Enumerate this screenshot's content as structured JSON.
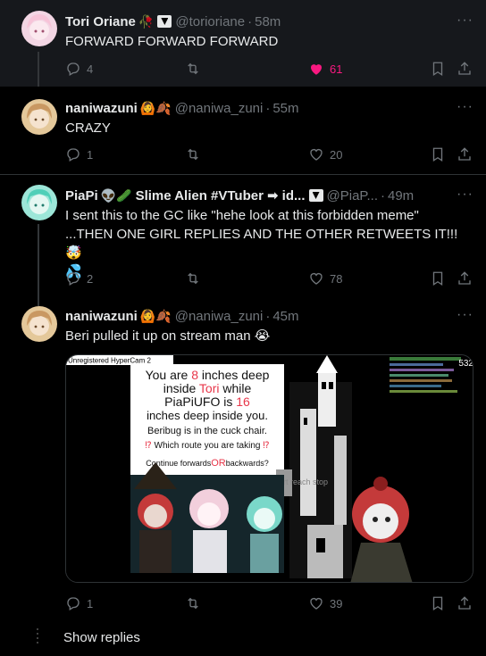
{
  "tweets": [
    {
      "name": "Tori Oriane",
      "name_emoji": "🥀",
      "handle": "@torioriane",
      "time": "58m",
      "text": "FORWARD FORWARD FORWARD",
      "replies": "4",
      "likes": "61",
      "liked": true
    },
    {
      "name": "naniwazuni",
      "name_emoji": "🙆🍂",
      "handle": "@naniwa_zuni",
      "time": "55m",
      "text": "CRAZY",
      "replies": "1",
      "likes": "20"
    },
    {
      "name": "PiaPi",
      "name_emoji": "👽🥒",
      "name_suffix": "Slime Alien #VTuber",
      "name_tail": "➡ id...",
      "handle": "@PiaP...",
      "time": "49m",
      "text_line1": "I sent this to the GC like \"hehe look at this forbidden meme\"",
      "text_line2": "...THEN ONE GIRL REPLIES AND THE OTHER RETWEETS IT!!! 🤯",
      "text_line3": "💦",
      "replies": "2",
      "likes": "78"
    },
    {
      "name": "naniwazuni",
      "name_emoji": "🙆🍂",
      "handle": "@naniwa_zuni",
      "time": "45m",
      "text": "Beri pulled it up on stream man 😭",
      "replies": "1",
      "likes": "39"
    }
  ],
  "media": {
    "watermark": "Unregistered HyperCam 2",
    "viewer_count": "532",
    "meme_line1a": "You are ",
    "meme_line1b": "8",
    "meme_line1c": " inches deep",
    "meme_line2a": "inside ",
    "meme_line2b": "Tori",
    "meme_line2c": " while",
    "meme_line3a": "PiaPiUFO",
    "meme_line3b": " is ",
    "meme_line3c": "16",
    "meme_line4": "inches deep inside you.",
    "meme_line5": "Beribug is in the cuck chair.",
    "meme_line6a": "⁉ ",
    "meme_line6b": "Which route you are taking",
    "meme_line6c": " ⁉",
    "meme_line7a": "Continue forwards",
    "meme_line7b": "OR",
    "meme_line7c": "backwards?",
    "castle_text": "art reach stop"
  },
  "show_replies": "Show replies",
  "colors": {
    "background": "#000000",
    "highlight": "#16181c",
    "like_pink": "#f91880",
    "meme_red": "#e8374a",
    "secondary": "#71767b"
  },
  "icons": [
    "reply-icon",
    "retweet-icon",
    "heart-icon",
    "bookmark-icon",
    "share-icon",
    "more-icon",
    "verified-icon"
  ]
}
